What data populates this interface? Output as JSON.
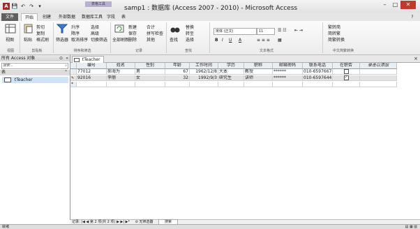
{
  "window": {
    "title": "samp1 : 数据库 (Access 2007 - 2010) - Microsoft Access",
    "context_tab_group": "表格工具",
    "controls": [
      "–",
      "□",
      "✕"
    ]
  },
  "quick_access": [
    "A",
    "💾",
    "↶",
    "↷",
    "▾"
  ],
  "ribbon_tabs": [
    "文件",
    "开始",
    "创建",
    "外部数据",
    "数据库工具",
    "字段",
    "表"
  ],
  "ribbon": {
    "groups": [
      {
        "label": "视图",
        "items": [
          "视图"
        ]
      },
      {
        "label": "剪贴板",
        "items": [
          "粘贴",
          "剪切",
          "复制",
          "格式刷"
        ]
      },
      {
        "label": "排序和筛选",
        "items": [
          "筛选器",
          "升序",
          "降序",
          "取消排序",
          "选择",
          "高级",
          "切换筛选"
        ]
      },
      {
        "label": "记录",
        "items": [
          "全部刷新",
          "新建",
          "保存",
          "删除",
          "合计",
          "拼写检查",
          "其他"
        ]
      },
      {
        "label": "查找",
        "items": [
          "查找",
          "替换",
          "转至",
          "选择"
        ]
      },
      {
        "label": "文本格式",
        "items": [
          "宋体 (正文)",
          "11",
          "B",
          "I",
          "U",
          "A"
        ]
      },
      {
        "label": "中文简繁转换",
        "items": [
          "繁转简",
          "简转繁",
          "简繁转换"
        ]
      }
    ]
  },
  "nav_pane": {
    "header": "所有 Access 对象",
    "search_placeholder": "搜索...",
    "group": "表",
    "items": [
      "tTeacher"
    ]
  },
  "document": {
    "tab": "tTeacher",
    "columns": [
      "编号",
      "姓名",
      "性别",
      "年龄",
      "工作时间",
      "学历",
      "职称",
      "邮箱密码",
      "联系电话",
      "在职否",
      "单击以添加"
    ],
    "rows": [
      [
        "77012",
        "郝海为",
        "男",
        "67",
        "1962/12/8",
        "大本",
        "教授",
        "******",
        "010-6597667",
        false,
        ""
      ],
      [
        "92016",
        "李丽",
        "女",
        "32",
        "1992/9/3",
        "研究生",
        "讲师",
        "******",
        "010-6597644",
        true,
        ""
      ]
    ],
    "record_nav": {
      "record_label": "记录:",
      "position": "第 2 项(共 2 项)",
      "filter_status": "无筛选器",
      "search_label": "搜索"
    }
  },
  "status_bar": {
    "left": "就绪"
  },
  "colors": {
    "file_tab": "#5f5f5f",
    "access_brand": "#9c2d2d",
    "close_button": "#c0392b",
    "selected_nav": "#cfe3f5"
  }
}
